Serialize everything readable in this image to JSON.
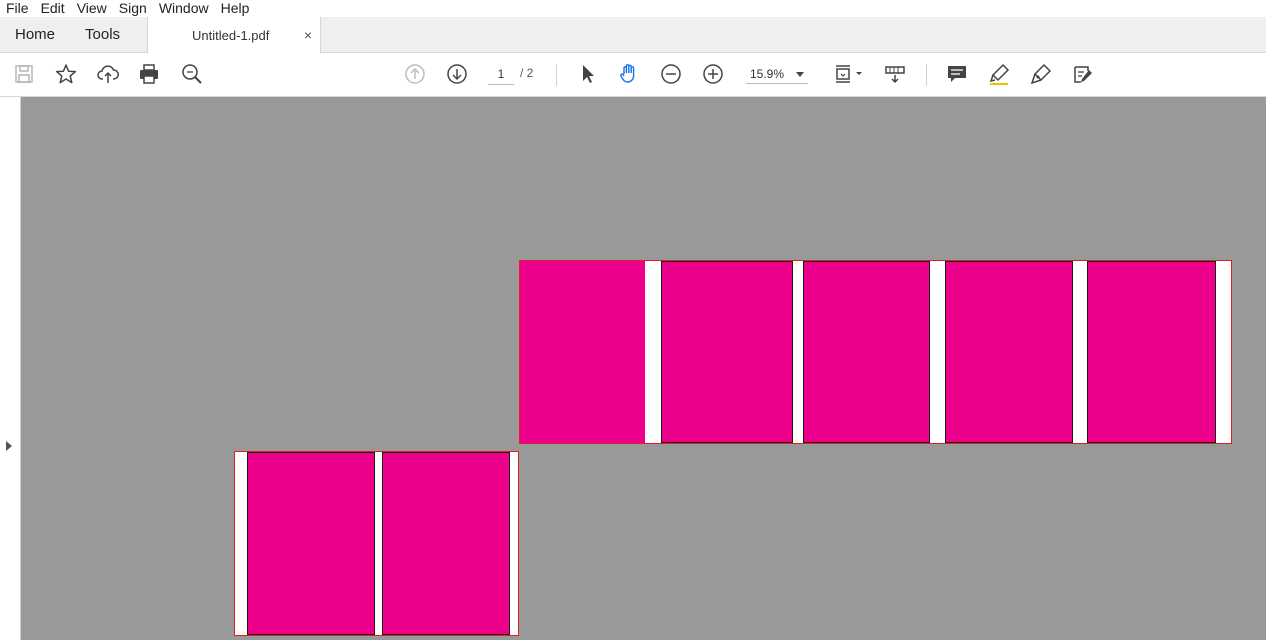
{
  "menu": {
    "items": [
      "File",
      "Edit",
      "View",
      "Sign",
      "Window",
      "Help"
    ]
  },
  "tabs": {
    "home": "Home",
    "tools": "Tools",
    "document": "Untitled-1.pdf",
    "close": "×"
  },
  "toolbar": {
    "icons": {
      "save": "save-icon",
      "bookmark": "star-icon",
      "upload": "cloud-upload-icon",
      "print": "print-icon",
      "search": "zoom-search-icon",
      "prev_page": "page-up-icon",
      "next_page": "page-down-icon",
      "select": "pointer-icon",
      "hand": "hand-icon",
      "zoom_out": "zoom-out-icon",
      "zoom_in": "zoom-in-icon",
      "fit": "page-fit-icon",
      "scroll": "scroll-mode-icon",
      "comment": "comment-icon",
      "highlight": "highlighter-icon",
      "sign": "sign-pen-icon",
      "edit": "edit-pdf-icon"
    },
    "page_current": "1",
    "page_total": "/ 2",
    "zoom_value": "15.9%"
  },
  "colors": {
    "magenta": "#ec008c",
    "canvas_gray": "#999999",
    "page_border": "#e02020",
    "hand_active": "#1473e6"
  }
}
